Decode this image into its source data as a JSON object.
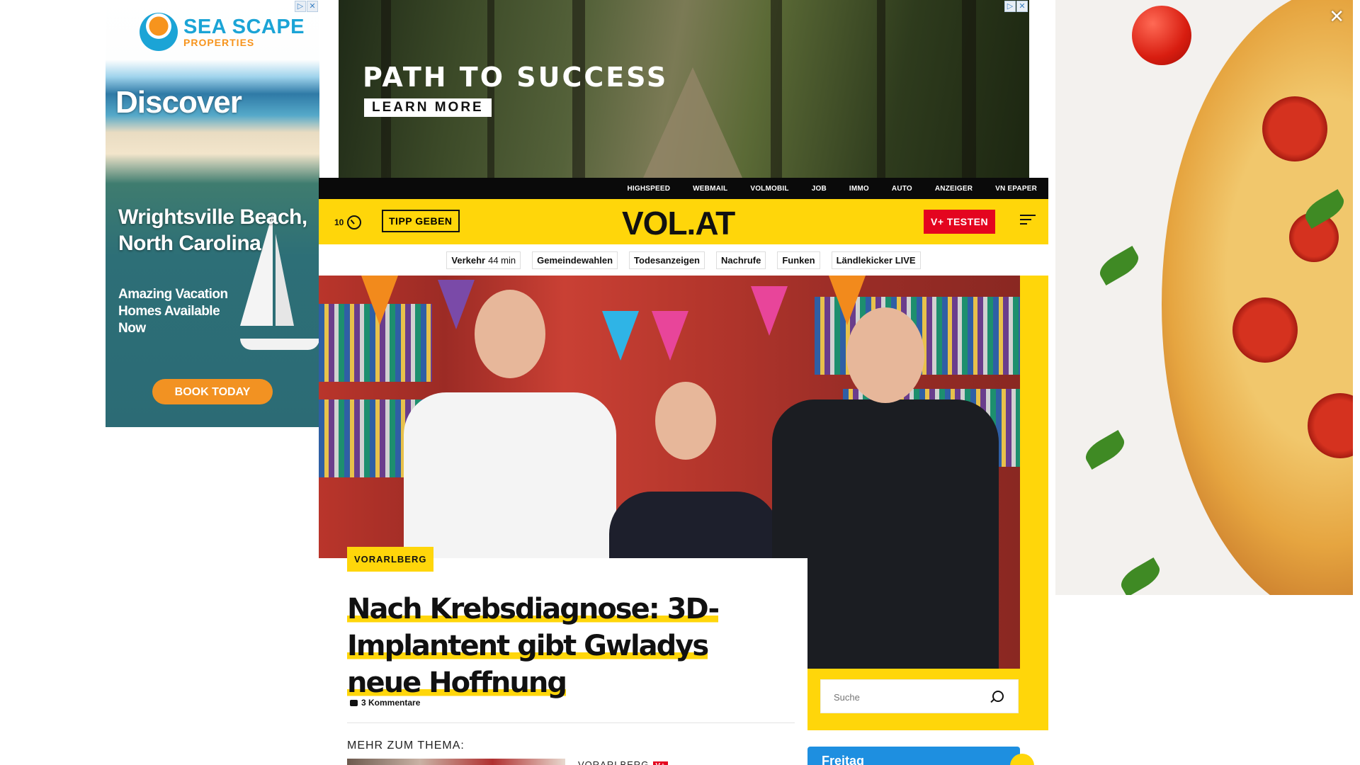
{
  "ads": {
    "left": {
      "brand": "SEA SCAPE",
      "brand_sub": "PROPERTIES",
      "headline": "Discover",
      "location": "Wrightsville Beach, North Carolina",
      "tagline": "Amazing Vacation Homes Available Now",
      "cta": "BOOK TODAY"
    },
    "top": {
      "headline": "PATH TO SUCCESS",
      "cta": "LEARN MORE"
    },
    "right": {
      "close_symbol": "✕"
    },
    "badge_info": "▷",
    "badge_close": "✕"
  },
  "site": {
    "topnav": [
      "HIGHSPEED",
      "WEBMAIL",
      "VOLMOBIL",
      "JOB",
      "IMMO",
      "AUTO",
      "ANZEIGER",
      "VN EPAPER"
    ],
    "header": {
      "counter": "10",
      "tip_button": "TIPP GEBEN",
      "logo": "VOL.AT",
      "vplus_button": "V+ TESTEN"
    },
    "chips": [
      {
        "label": "Verkehr",
        "sub": "44 min"
      },
      {
        "label": "Gemeindewahlen",
        "sub": ""
      },
      {
        "label": "Todesanzeigen",
        "sub": ""
      },
      {
        "label": "Nachrufe",
        "sub": ""
      },
      {
        "label": "Funken",
        "sub": ""
      },
      {
        "label": "Ländlekicker LIVE",
        "sub": ""
      }
    ],
    "article": {
      "category": "VORARLBERG",
      "headline": "Nach Krebsdiagnose: 3D-Implantent gibt Gwladys neue Hoffnung",
      "comments": "3 Kommentare",
      "more_label": "MEHR ZUM THEMA:",
      "related_category": "VORARLBERG",
      "related_badge": "V+"
    },
    "search": {
      "placeholder": "Suche"
    },
    "weather": {
      "day": "Freitag"
    }
  }
}
